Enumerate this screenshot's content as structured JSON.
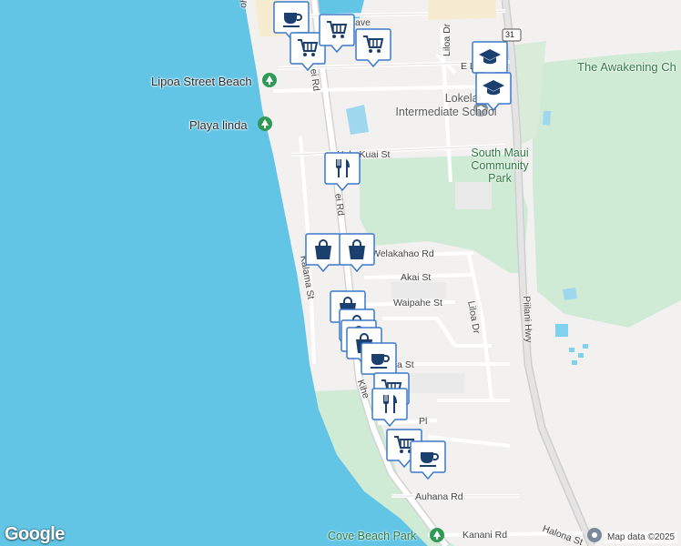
{
  "map": {
    "colors": {
      "water": "#63c5e6",
      "land": "#f2f1f0",
      "park": "#cfead5",
      "road": "#ffffff",
      "road_outline": "#d6d6d6",
      "highway": "#dadada",
      "marker_fill": "#ffffff",
      "marker_border": "#3a78c9",
      "marker_icon": "#1b3f6e",
      "park_icon": "#2f9a55"
    },
    "places": {
      "lipoa_beach": "Lipoa Street Beach",
      "playa_linda": "Playa linda",
      "awakening": "The Awakening Ch",
      "school_line1": "Lokelani",
      "school_line2": "Intermediate School",
      "park_line1": "South Maui",
      "park_line2": "Community",
      "park_line3": "Park",
      "cove_beach": "Cove Beach Park"
    },
    "roads": {
      "top_ave": "ave",
      "top_left": "ohunui Rd",
      "kihei_rd_1": "ei Rd",
      "kihei_rd_2": "ei Rd",
      "e_lipoa": "E L",
      "liloa_dr_top": "Liloa Dr",
      "hale_kuai": "Hale Kuai St",
      "welakahao": "Welakahao Rd",
      "kalama": "Kalama St",
      "akai": "Akai St",
      "waipahe": "Waipahe St",
      "liloa_dr": "Liloa Dr",
      "piilani": "Piilani Hwy",
      "mid_st": "a St",
      "kihei_lower": "Kihe",
      "lower_pl": "Pl",
      "auhana": "Auhana Rd",
      "kanani": "Kanani Rd",
      "halona": "Halona St",
      "route_shield": "31"
    },
    "markers": [
      {
        "icon": "coffee-icon"
      },
      {
        "icon": "shopping-cart-icon"
      },
      {
        "icon": "shopping-cart-icon"
      },
      {
        "icon": "shopping-cart-icon"
      },
      {
        "icon": "school-icon"
      },
      {
        "icon": "school-icon"
      },
      {
        "icon": "restaurant-icon"
      },
      {
        "icon": "shopping-bag-icon"
      },
      {
        "icon": "shopping-bag-icon"
      },
      {
        "icon": "shopping-bag-icon"
      },
      {
        "icon": "shopping-bag-icon"
      },
      {
        "icon": "shopping-bag-icon"
      },
      {
        "icon": "shopping-bag-icon"
      },
      {
        "icon": "coffee-icon"
      },
      {
        "icon": "shopping-cart-icon"
      },
      {
        "icon": "restaurant-icon"
      },
      {
        "icon": "shopping-cart-icon"
      },
      {
        "icon": "coffee-icon"
      }
    ],
    "google_logo": "Google",
    "attribution": "Map data ©2025"
  }
}
